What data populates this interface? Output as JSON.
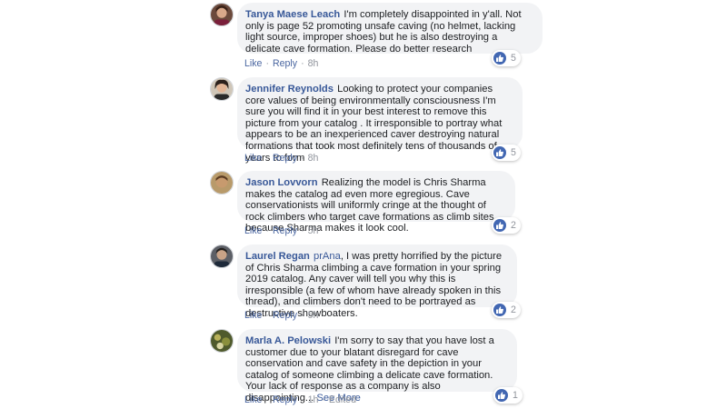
{
  "actions": {
    "like": "Like",
    "reply": "Reply",
    "separator": "·"
  },
  "comments": [
    {
      "author": "Tanya Maese Leach",
      "text": "I'm completely disappointed in y'all. Not only is page 52 promoting unsafe caving (no helmet, lacking light source, improper shoes) but he is also destroying a delicate cave formation. Please do better research",
      "time": "8h",
      "reactions": "5"
    },
    {
      "author": "Jennifer Reynolds",
      "text": "Looking to protect your companies core values of being environmentally consciousness I'm sure you will find it in your best interest to remove this picture from your catalog . It irresponsible to portray what appears to be an inexperienced caver destroying natural formations that took most definitely tens of thousands of years to form",
      "time": "8h",
      "reactions": "5"
    },
    {
      "author": "Jason Lovvorn",
      "text": "Realizing the model is Chris Sharma makes the catalog ad even more egregious. Cave conservationists will uniformly cringe at the thought of rock climbers who target cave formations as climb sites because Sharma makes it look cool.",
      "time": "5h",
      "reactions": "2"
    },
    {
      "author": "Laurel Regan",
      "mention": "prAna",
      "text": ", I was pretty horrified by the picture of Chris Sharma climbing a cave formation in your spring 2019 catalog. Any caver will tell you why this is irresponsible (a few of whom have already spoken in this thread), and climbers don't need to be portrayed as destructive showboaters.",
      "time": "5h",
      "reactions": "2"
    },
    {
      "author": "Marla A. Pelowski",
      "text": "I'm sorry to say that you have lost a customer due to your blatant disregard for cave conservation and cave safety in the depiction in your catalog of someone climbing a delicate cave formation. Your lack of response as a company is also disappointing...",
      "see_more": "See More",
      "time": "1h",
      "edited": "Edited",
      "reactions": "1"
    }
  ],
  "colors": {
    "author": "#385898",
    "bubble": "#f2f3f5",
    "like_badge": "#4267b2"
  },
  "icons": {
    "reaction": "like-thumbs-up-icon",
    "avatar": "user-avatar"
  }
}
